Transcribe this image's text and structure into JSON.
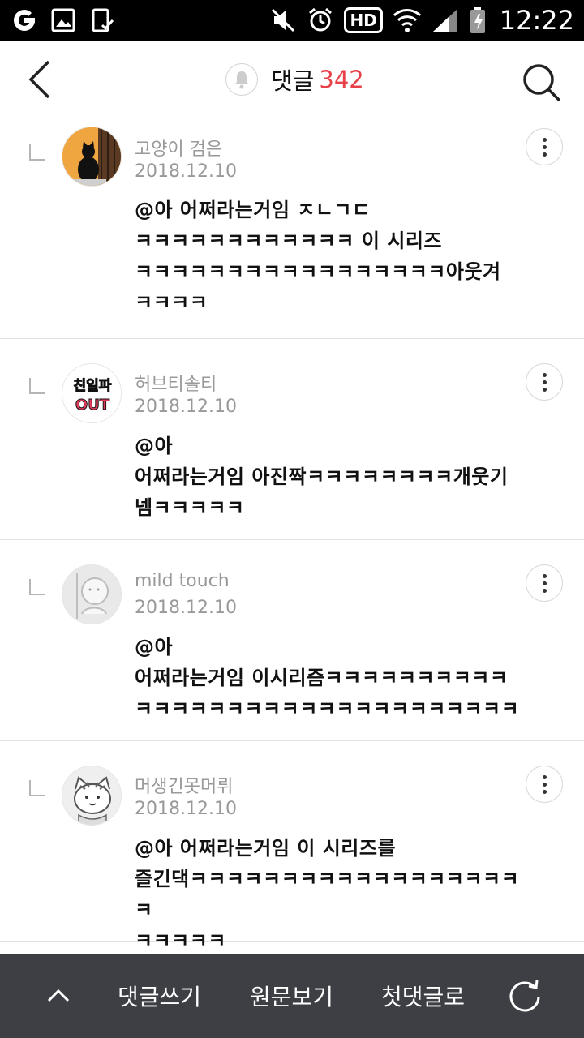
{
  "status_bar": {
    "time": "12:22",
    "hd_label": "HD",
    "icons": [
      "g-app-icon",
      "gallery-icon",
      "task-icon",
      "mute-icon",
      "alarm-icon",
      "hd-badge",
      "wifi-icon",
      "signal-icon",
      "battery-icon"
    ]
  },
  "header": {
    "title": "댓글",
    "count": "342",
    "count_color": "#e8414a",
    "icons": [
      "back-arrow-icon",
      "bell-icon",
      "search-icon"
    ]
  },
  "comments": [
    {
      "author": "고양이 검은",
      "date": "2018.12.10",
      "text": "@아 어쩌라는거임 ㅈㄴㄱㄷ\nㅋㅋㅋㅋㅋㅋㅋㅋㅋㅋㅋㅋ 이 시리즈\nㅋㅋㅋㅋㅋㅋㅋㅋㅋㅋㅋㅋㅋㅋㅋㅋㅋ아웃겨\nㅋㅋㅋㅋ",
      "avatar": "black-cat-avatar"
    },
    {
      "author": "허브티솔티",
      "date": "2018.12.10",
      "text": "@아\n어쩌라는거임 아진짝ㅋㅋㅋㅋㅋㅋㅋㅋ개웃기\n넴ㅋㅋㅋㅋㅋ",
      "avatar": "sticker-avatar",
      "avatar_text_top": "친일파",
      "avatar_text_bottom": "OUT"
    },
    {
      "author": "mild touch",
      "date": "2018.12.10",
      "text": "@아\n어쩌라는거임 이시리즘ㅋㅋㅋㅋㅋㅋㅋㅋㅋㅋ\nㅋㅋㅋㅋㅋㅋㅋㅋㅋㅋㅋㅋㅋㅋㅋㅋㅋㅋㅋㅋㅋ",
      "avatar": "default-avatar"
    },
    {
      "author": "머생긴못머뤼",
      "date": "2018.12.10",
      "text": "@아 어쩌라는거임 이 시리즈를\n즐긴댁ㅋㅋㅋㅋㅋㅋㅋㅋㅋㅋㅋㅋㅋㅋㅋㅋㅋㅋㅋ\nㅋㅋㅋㅋㅋ",
      "avatar": "cartoon-cat-avatar"
    }
  ],
  "bottom_bar": {
    "write": "댓글쓰기",
    "original": "원문보기",
    "first": "첫댓글로",
    "icons": [
      "chevron-up-icon",
      "refresh-icon"
    ]
  }
}
